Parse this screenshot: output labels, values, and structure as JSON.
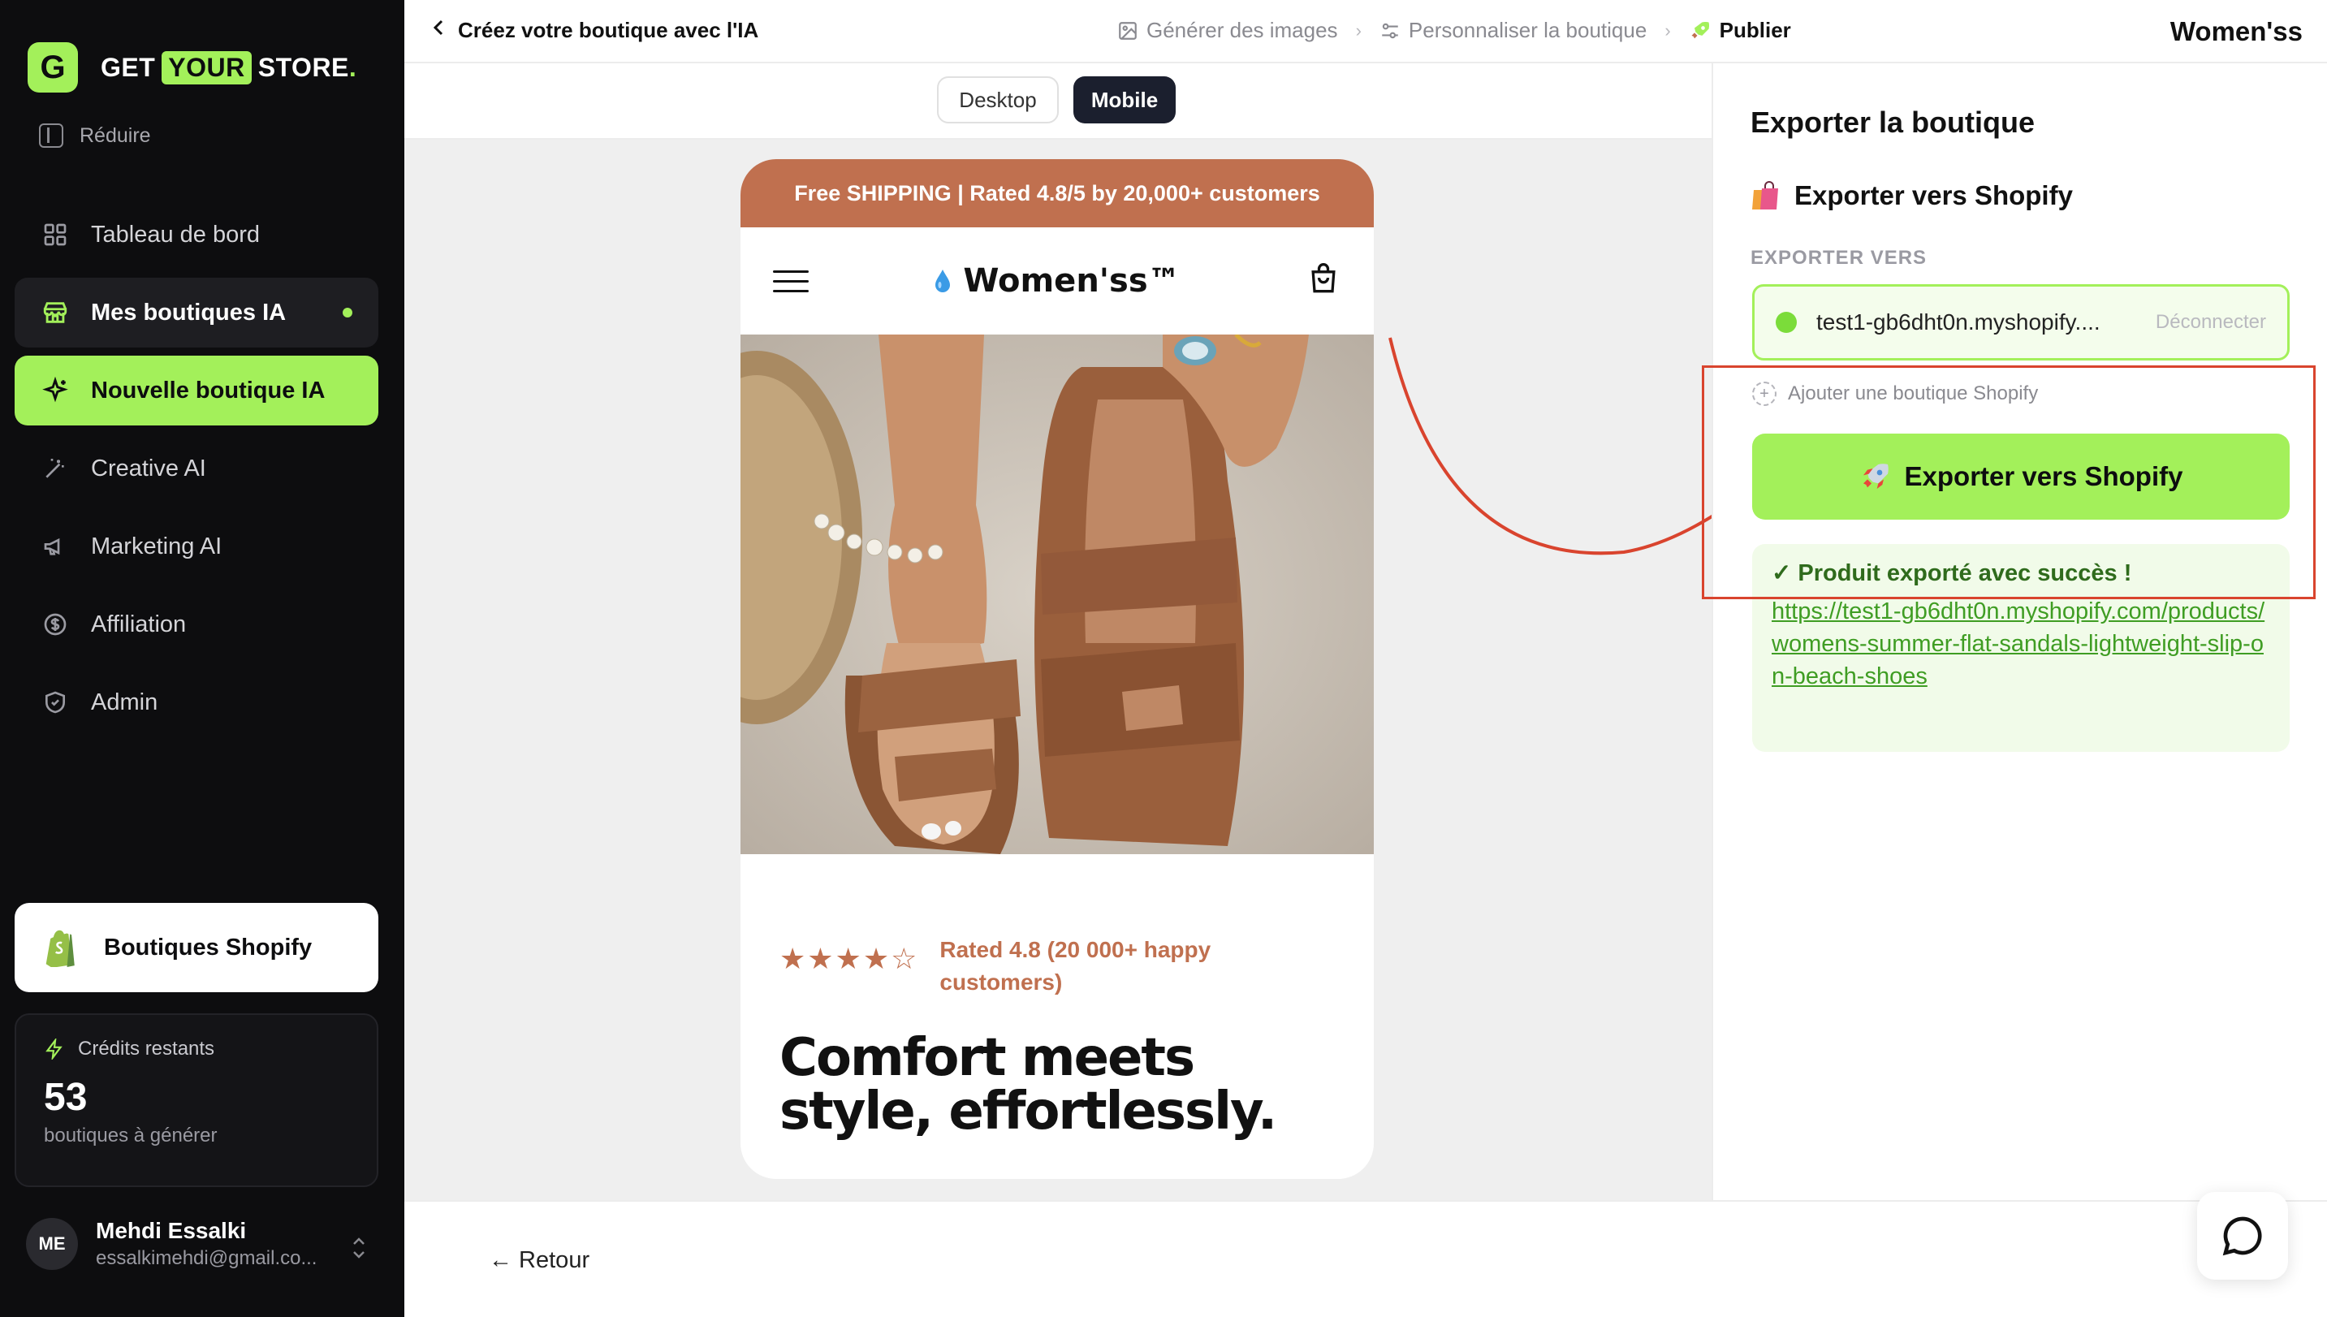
{
  "sidebar": {
    "logo": {
      "badge": "G",
      "word1": "GET",
      "word2": "YOUR",
      "word3": "STORE",
      "dot": "."
    },
    "reduce_label": "Réduire",
    "items": [
      {
        "label": "Tableau de bord",
        "icon": "grid-icon"
      },
      {
        "label": "Mes boutiques IA",
        "icon": "store-icon",
        "state": "active"
      },
      {
        "label": "Nouvelle boutique IA",
        "icon": "sparkle-icon",
        "state": "primary"
      },
      {
        "label": "Creative AI",
        "icon": "magic-wand-icon"
      },
      {
        "label": "Marketing AI",
        "icon": "megaphone-icon"
      },
      {
        "label": "Affiliation",
        "icon": "dollar-icon"
      },
      {
        "label": "Admin",
        "icon": "shield-icon"
      }
    ],
    "shopify_card": {
      "label": "Boutiques Shopify"
    },
    "credits": {
      "title": "Crédits restants",
      "value": "53",
      "subtitle": "boutiques à générer"
    },
    "user": {
      "initials": "ME",
      "name": "Mehdi Essalki",
      "email": "essalkimehdi@gmail.co..."
    }
  },
  "topbar": {
    "back_label": "Créez votre boutique avec l'IA",
    "breadcrumbs": [
      {
        "label": "Générer des images",
        "icon": "image-icon"
      },
      {
        "label": "Personnaliser la boutique",
        "icon": "settings-sliders-icon"
      },
      {
        "label": "Publier",
        "icon": "rocket-icon"
      }
    ],
    "store_name": "Women'ss"
  },
  "view_toggle": {
    "desktop": "Desktop",
    "mobile": "Mobile",
    "selected": "Mobile"
  },
  "preview": {
    "announcement": "Free SHIPPING | Rated 4.8/5 by 20,000+ customers",
    "brand": "Women'ss™",
    "stars": "★★★★☆",
    "rating_text": "Rated 4.8 (20 000+ happy customers)",
    "headline": "Comfort meets style, effortlessly."
  },
  "export_panel": {
    "title": "Exporter la boutique",
    "subtitle": "Exporter vers Shopify",
    "export_to_label": "EXPORTER VERS",
    "connected_domain": "test1-gb6dht0n.myshopify....",
    "disconnect_label": "Déconnecter",
    "add_store_label": "Ajouter une boutique Shopify",
    "export_button": "Exporter vers Shopify",
    "success_message": "✓ Produit exporté avec succès !",
    "product_url": "https://test1-gb6dht0n.myshopify.com/products/womens-summer-flat-sandals-lightweight-slip-on-beach-shoes"
  },
  "bottom": {
    "back_label": "← Retour"
  },
  "colors": {
    "accent": "#a3f05a",
    "sidebar_bg": "#0d0d0f",
    "brand_terracotta": "#c0704f",
    "annotation_red": "#d9442e"
  }
}
